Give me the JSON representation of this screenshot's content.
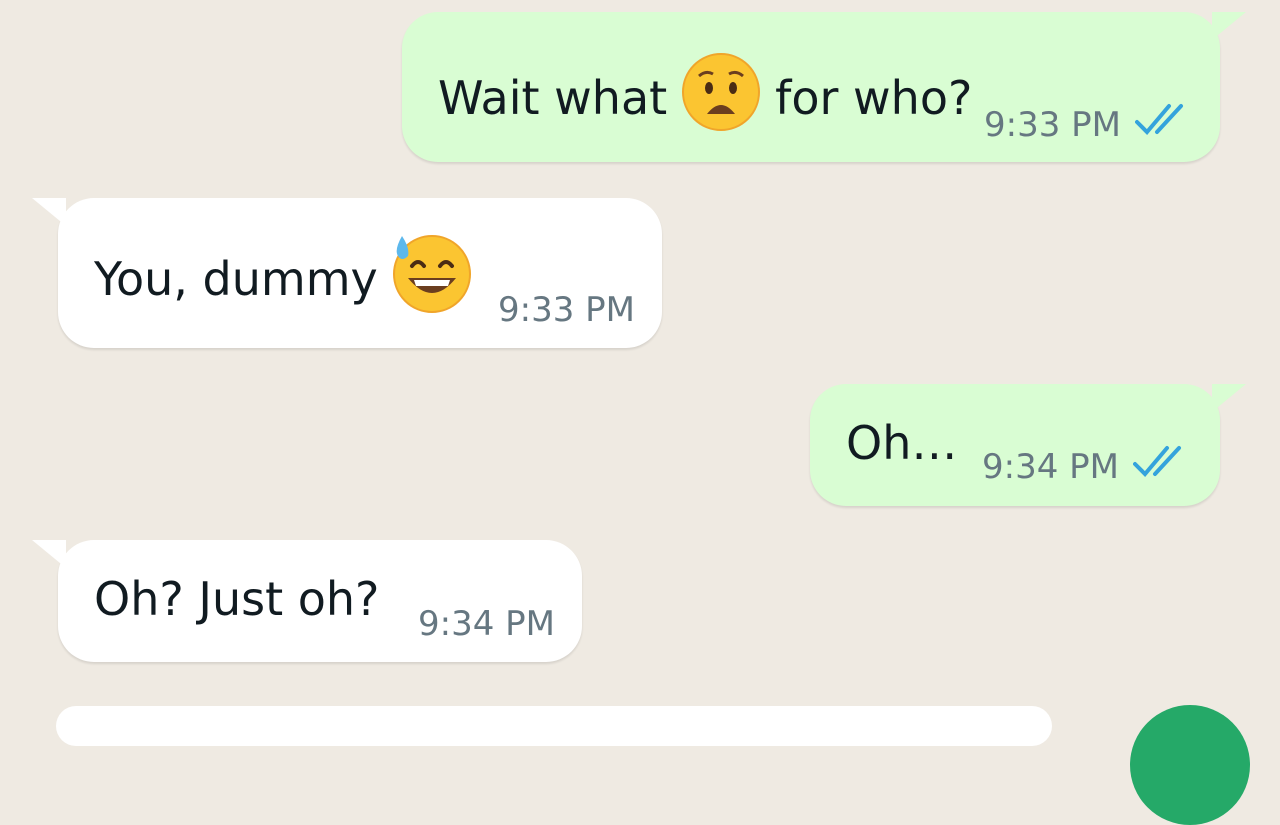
{
  "colors": {
    "background": "#efeae2",
    "outgoing_bubble": "#d9fdd3",
    "incoming_bubble": "#ffffff",
    "read_ticks": "#34a3dc",
    "timestamp": "#667781",
    "fab": "#25a968"
  },
  "messages": [
    {
      "direction": "outgoing",
      "text_before": "Wait what",
      "emoji": "worried-face-icon",
      "text_after": "for who?",
      "time": "9:33 PM",
      "status": "read"
    },
    {
      "direction": "incoming",
      "text_before": "You, dummy",
      "emoji": "grinning-face-with-sweat-icon",
      "text_after": "",
      "time": "9:33 PM"
    },
    {
      "direction": "outgoing",
      "text_before": "Oh…",
      "time": "9:34 PM",
      "status": "read"
    },
    {
      "direction": "incoming",
      "text_before": "Oh? Just oh?",
      "time": "9:34 PM"
    }
  ]
}
